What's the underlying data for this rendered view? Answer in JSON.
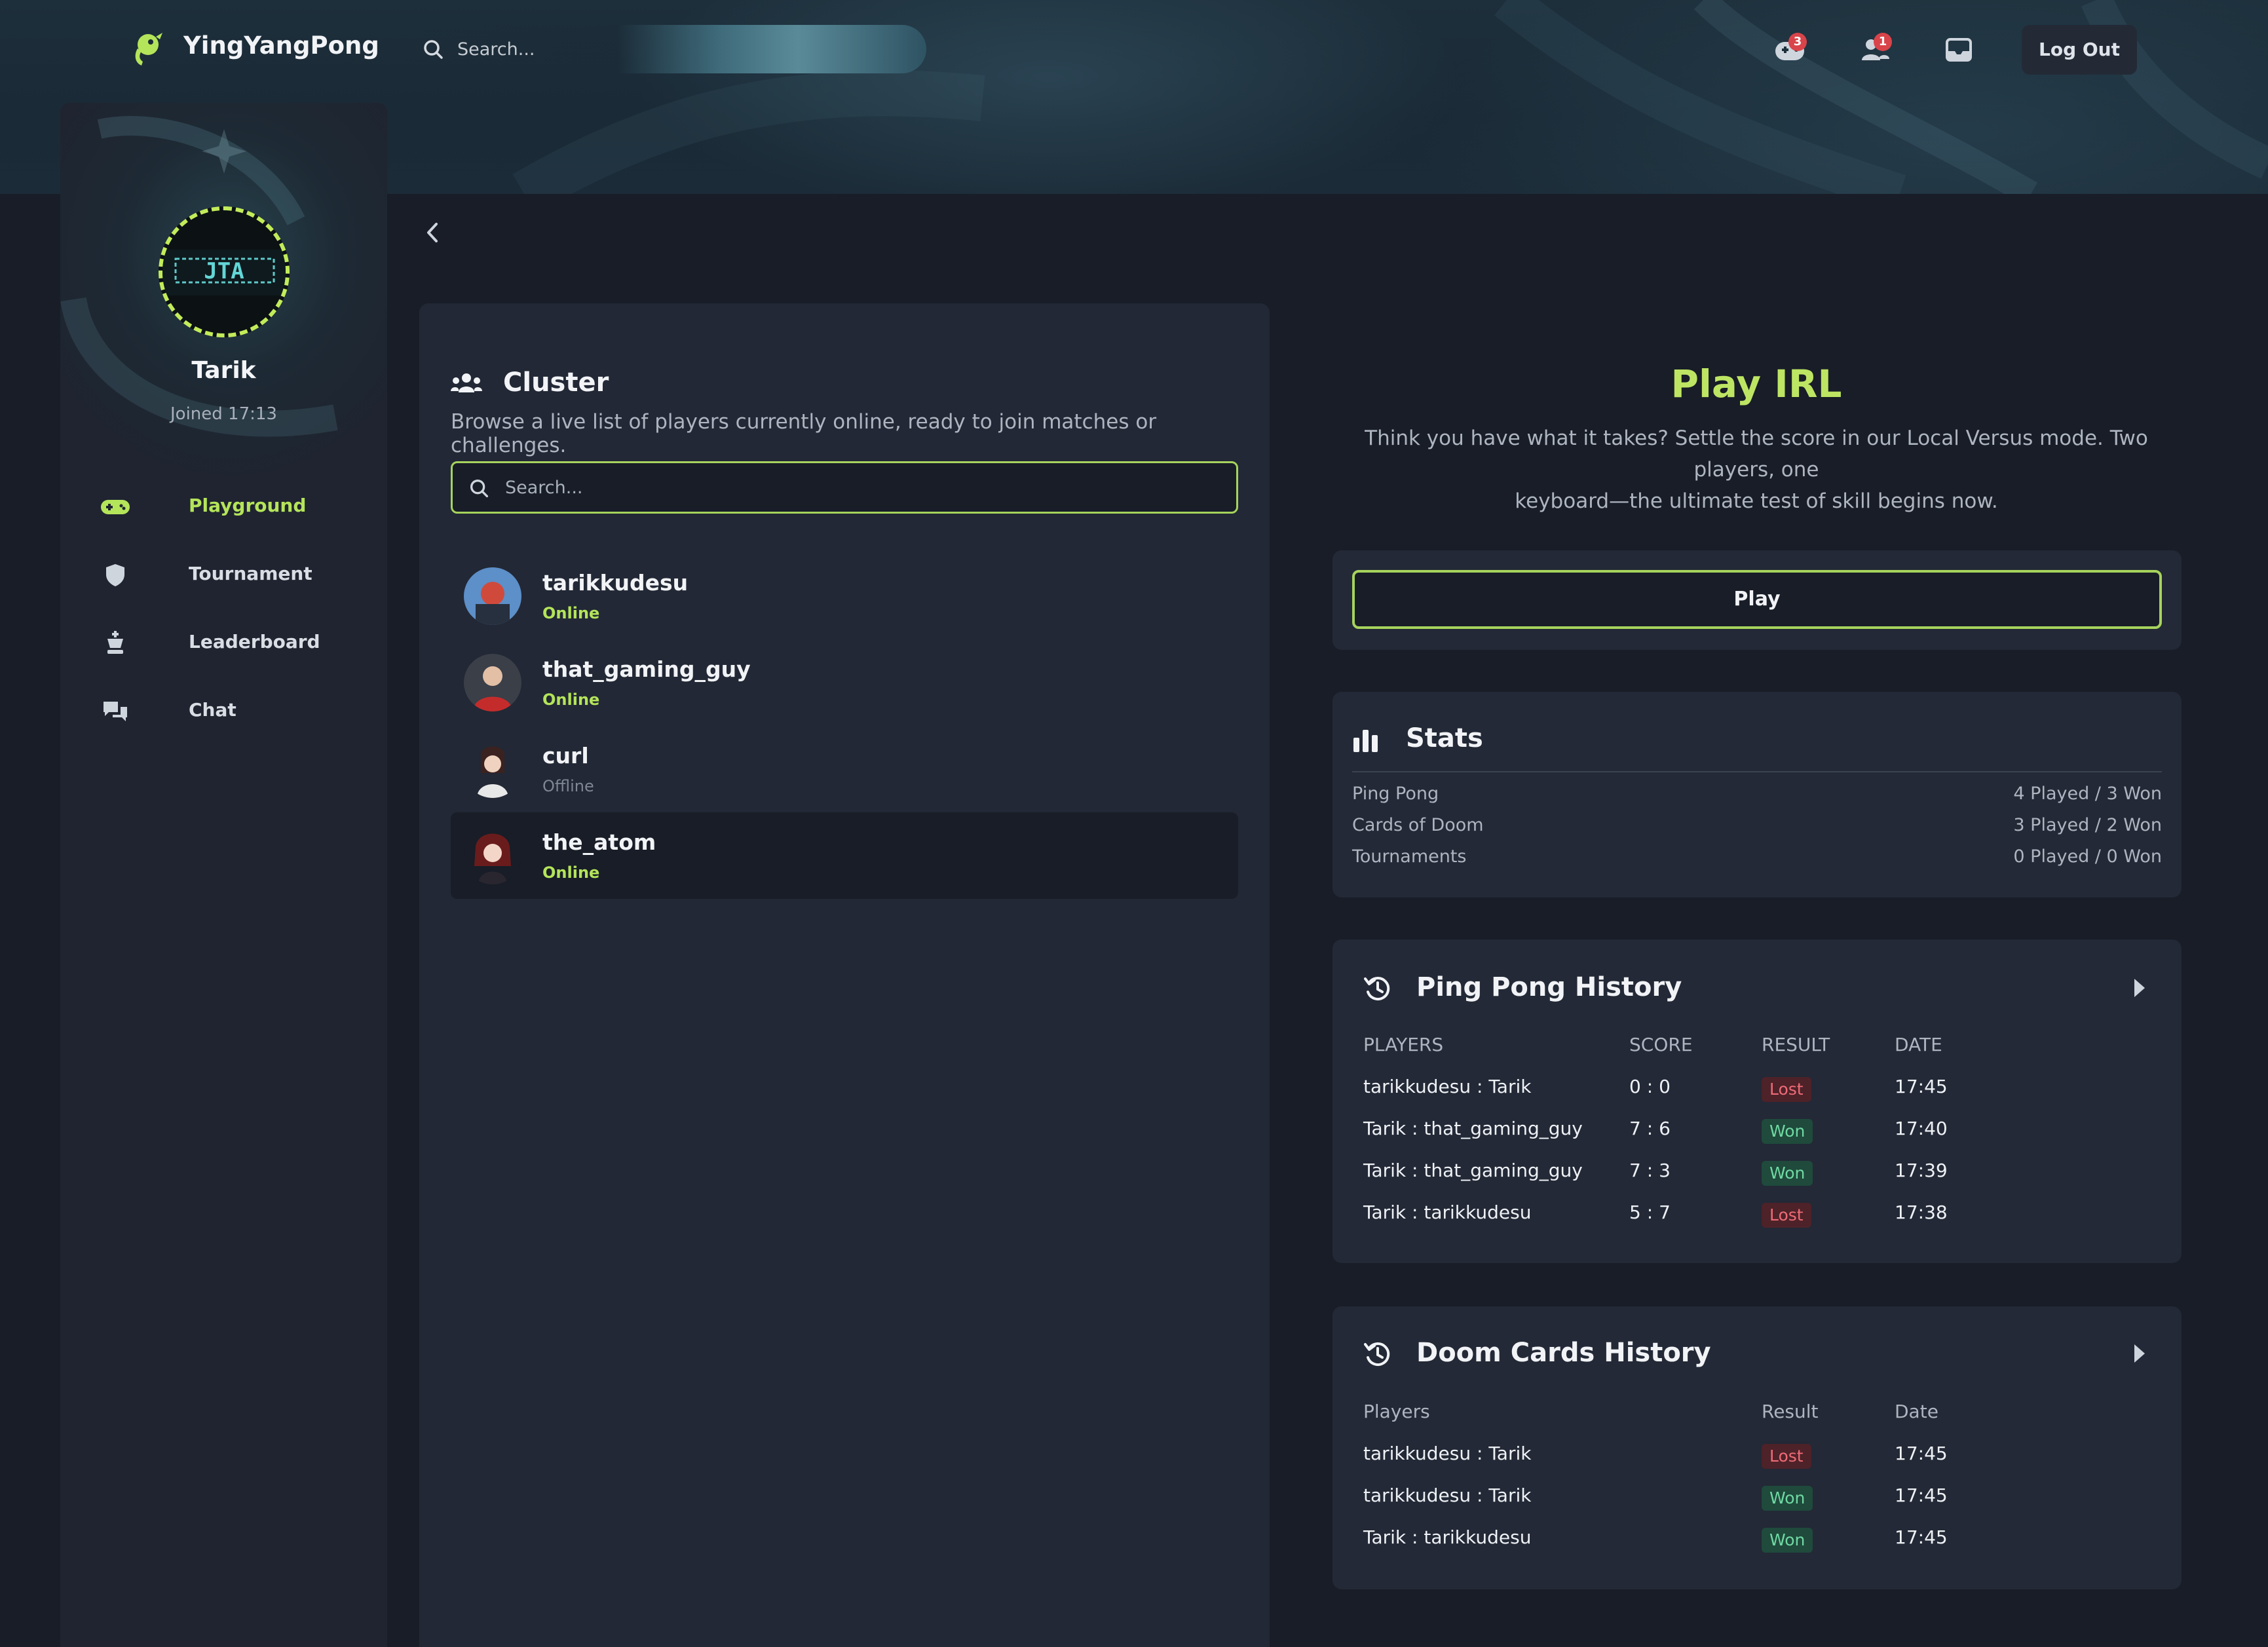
{
  "app": {
    "brand": "YingYangPong"
  },
  "topbar": {
    "search_placeholder": "Search...",
    "games_badge": "3",
    "friends_badge": "1",
    "logout_label": "Log Out"
  },
  "profile": {
    "name": "Tarik",
    "joined": "Joined 17:13",
    "avatar_text": "JTA"
  },
  "nav": [
    {
      "label": "Playground",
      "icon": "gamepad-icon"
    },
    {
      "label": "Tournament",
      "icon": "shield-icon"
    },
    {
      "label": "Leaderboard",
      "icon": "chess-king-icon"
    },
    {
      "label": "Chat",
      "icon": "chat-bubbles-icon"
    }
  ],
  "cluster": {
    "title": "Cluster",
    "description": "Browse a live list of players currently online, ready to join matches or challenges.",
    "search_placeholder": "Search...",
    "players": [
      {
        "name": "tarikkudesu",
        "status": "Online"
      },
      {
        "name": "that_gaming_guy",
        "status": "Online"
      },
      {
        "name": "curl",
        "status": "Offline"
      },
      {
        "name": "the_atom",
        "status": "Online"
      }
    ]
  },
  "irl": {
    "title": "Play IRL",
    "description_line1": "Think you have what it takes? Settle the score in our Local Versus mode. Two players, one",
    "description_line2": "keyboard—the ultimate test of skill begins now.",
    "play_label": "Play"
  },
  "stats": {
    "title": "Stats",
    "rows": [
      {
        "label": "Ping Pong",
        "value": "4 Played / 3 Won"
      },
      {
        "label": "Cards of Doom",
        "value": "3 Played / 2 Won"
      },
      {
        "label": "Tournaments",
        "value": "0 Played / 0 Won"
      }
    ]
  },
  "pingpong": {
    "title": "Ping Pong History",
    "headers": {
      "players": "PLAYERS",
      "score": "SCORE",
      "result": "RESULT",
      "date": "DATE"
    },
    "rows": [
      {
        "p1": "tarikkudesu",
        "p2": "Tarik",
        "s1": "0",
        "s2": "0",
        "result": "Lost",
        "date": "17:45"
      },
      {
        "p1": "Tarik",
        "p2": "that_gaming_guy",
        "s1": "7",
        "s2": "6",
        "result": "Won",
        "date": "17:40"
      },
      {
        "p1": "Tarik",
        "p2": "that_gaming_guy",
        "s1": "7",
        "s2": "3",
        "result": "Won",
        "date": "17:39"
      },
      {
        "p1": "Tarik",
        "p2": "tarikkudesu",
        "s1": "5",
        "s2": "7",
        "result": "Lost",
        "date": "17:38"
      }
    ]
  },
  "doom": {
    "title": "Doom Cards History",
    "headers": {
      "players": "Players",
      "result": "Result",
      "date": "Date"
    },
    "rows": [
      {
        "p1": "tarikkudesu",
        "p2": "Tarik",
        "result": "Lost",
        "date": "17:45"
      },
      {
        "p1": "tarikkudesu",
        "p2": "Tarik",
        "result": "Won",
        "date": "17:45"
      },
      {
        "p1": "Tarik",
        "p2": "tarikkudesu",
        "result": "Won",
        "date": "17:45"
      }
    ]
  },
  "colors": {
    "accent": "#b4e45a",
    "background": "#181d27",
    "card": "#232936",
    "lost": "#ee6b76",
    "won": "#6fd9a2"
  }
}
